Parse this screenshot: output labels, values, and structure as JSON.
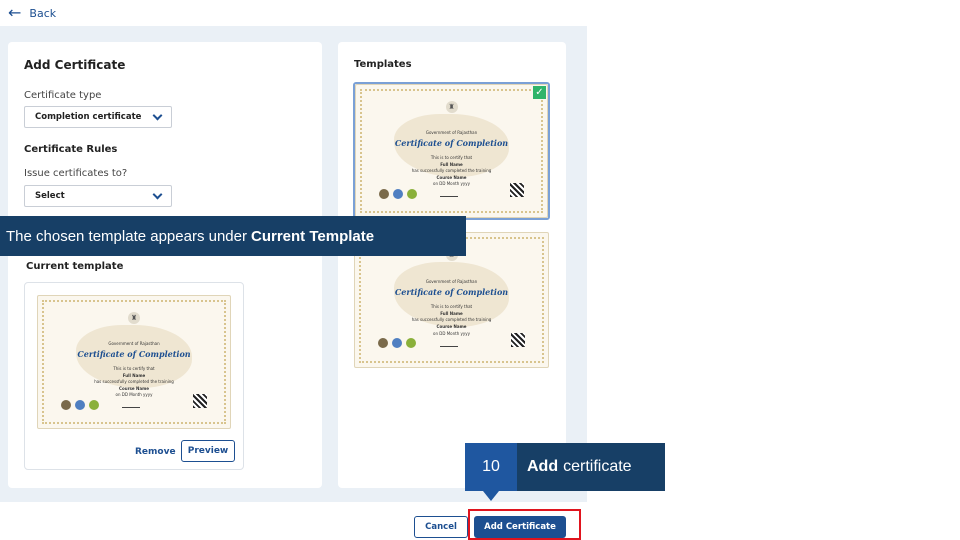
{
  "nav": {
    "back_label": "Back"
  },
  "form": {
    "title": "Add Certificate",
    "certificate_type_label": "Certificate type",
    "certificate_type_value": "Completion certificate",
    "rules_heading": "Certificate Rules",
    "issue_to_label": "Issue certificates to?",
    "issue_to_value": "Select",
    "current_template_heading": "Current template",
    "remove_label": "Remove",
    "preview_label": "Preview"
  },
  "templates": {
    "heading": "Templates"
  },
  "certificate": {
    "dept": "Government of Rajasthan",
    "title": "Certificate of Completion",
    "certify": "This is to certify that",
    "name": "Full Name",
    "completed": "has successfully completed the training",
    "course": "Course Name",
    "date": "on DD Month yyyy"
  },
  "actions": {
    "cancel_label": "Cancel",
    "add_label": "Add Certificate"
  },
  "annotation": {
    "callout_text": "The chosen template appears under",
    "callout_bold": "Current Template",
    "step_number": "10",
    "step_bold": "Add",
    "step_text": "certificate"
  },
  "colors": {
    "primary": "#1d4f91",
    "callout_bg": "#173f66",
    "highlight": "#e0141e",
    "check": "#2fb46a"
  }
}
